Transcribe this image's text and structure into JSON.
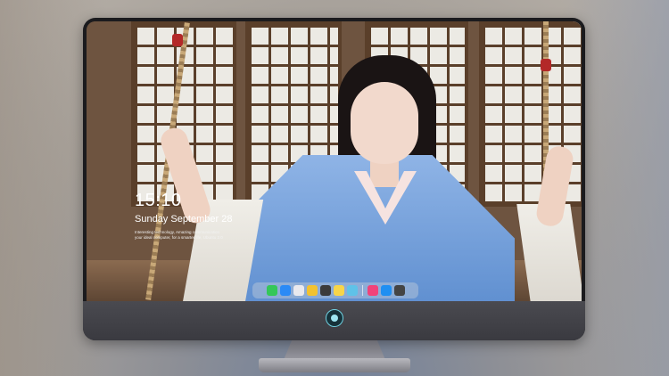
{
  "lock_screen": {
    "time": "15:10",
    "date": "Sunday September 28",
    "caption_line1": "Interesting technology, Amazing communication",
    "caption_line2": "your ideal computer, for a smarter life, Ubuntu 2.0"
  },
  "dock": {
    "apps": [
      {
        "name": "messages-icon",
        "color": "#34c759"
      },
      {
        "name": "files-icon",
        "color": "#2a8af6"
      },
      {
        "name": "safari-icon",
        "color": "#e9e9ee"
      },
      {
        "name": "video-player-icon",
        "color": "#f2c230"
      },
      {
        "name": "clapperboard-icon",
        "color": "#3b3b3b"
      },
      {
        "name": "notes-icon",
        "color": "#f7d54a"
      },
      {
        "name": "photos-icon",
        "color": "#5fc2e8"
      },
      {
        "name": "music-icon",
        "color": "#f0437a"
      },
      {
        "name": "app-store-icon",
        "color": "#1f8ff2"
      },
      {
        "name": "terminal-icon",
        "color": "#444444"
      }
    ]
  },
  "colors": {
    "monitor_bezel": "#1b1b1e",
    "chin": "#3f3f45",
    "dock_bg": "rgba(220,220,220,0.35)",
    "rope_tie": "#b32828",
    "dress": "#6f9ad8"
  }
}
